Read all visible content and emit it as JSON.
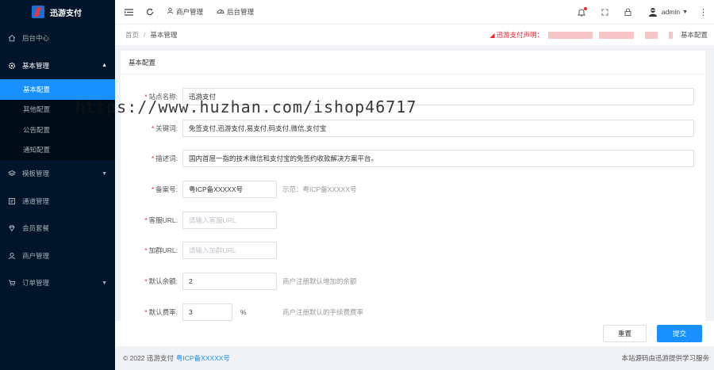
{
  "app": {
    "name": "迅游支付"
  },
  "sidebar": {
    "items": [
      {
        "label": "后台中心",
        "icon": "home-icon"
      },
      {
        "label": "基本管理",
        "icon": "gear-icon",
        "open": true,
        "children": [
          {
            "label": "基本配置",
            "active": true
          },
          {
            "label": "其他配置"
          },
          {
            "label": "公告配置"
          },
          {
            "label": "通知配置"
          }
        ]
      },
      {
        "label": "模板管理",
        "icon": "layers-icon"
      },
      {
        "label": "通道管理",
        "icon": "channel-icon"
      },
      {
        "label": "会员套餐",
        "icon": "diamond-icon"
      },
      {
        "label": "商户管理",
        "icon": "user-icon"
      },
      {
        "label": "订单管理",
        "icon": "cart-icon"
      }
    ]
  },
  "topbar": {
    "tabs": [
      {
        "label": "商户管理",
        "icon": "user-icon"
      },
      {
        "label": "后台管理",
        "icon": "dashboard-icon"
      }
    ],
    "user": "admin"
  },
  "breadcrumb": {
    "home": "首页",
    "sep": "/",
    "current": "基本管理",
    "notice_label": "迅游支付声明：",
    "right_label": "基本配置"
  },
  "card": {
    "title": "基本配置"
  },
  "form": {
    "fields": [
      {
        "label": "站点名称:",
        "required": true,
        "value": "迅游支付",
        "placeholder": "",
        "hint": ""
      },
      {
        "label": "关键词:",
        "required": true,
        "value": "免签支付,迅游支付,易支付,码支付,微信,支付宝",
        "placeholder": "",
        "hint": ""
      },
      {
        "label": "描述词:",
        "required": true,
        "value": "国内首屈一指的技术微信和支付宝的免签约收款解决方案平台。",
        "placeholder": "",
        "hint": ""
      },
      {
        "label": "备案号:",
        "required": true,
        "value": "粤ICP备XXXXX号",
        "placeholder": "",
        "hint": "示范：粤ICP备XXXXX号"
      },
      {
        "label": "客服URL:",
        "required": true,
        "value": "",
        "placeholder": "请输入客服URL",
        "hint": ""
      },
      {
        "label": "加群URL:",
        "required": true,
        "value": "",
        "placeholder": "请输入加群URL",
        "hint": ""
      },
      {
        "label": "默认余额:",
        "required": true,
        "value": "2",
        "placeholder": "",
        "hint": "商户注册默认增加的余额"
      },
      {
        "label": "默认费率:",
        "required": true,
        "value": "3",
        "placeholder": "",
        "unit": "%",
        "hint": "商户注册默认的手续费费率"
      }
    ]
  },
  "buttons": {
    "reset": "重置",
    "submit": "提交"
  },
  "footer": {
    "copyright": "© 2022 迅游支付",
    "icp": "粤ICP备XXXXX号",
    "right": "本站源码由迅游提供学习服务"
  },
  "watermark": "https://www.huzhan.com/ishop46717"
}
